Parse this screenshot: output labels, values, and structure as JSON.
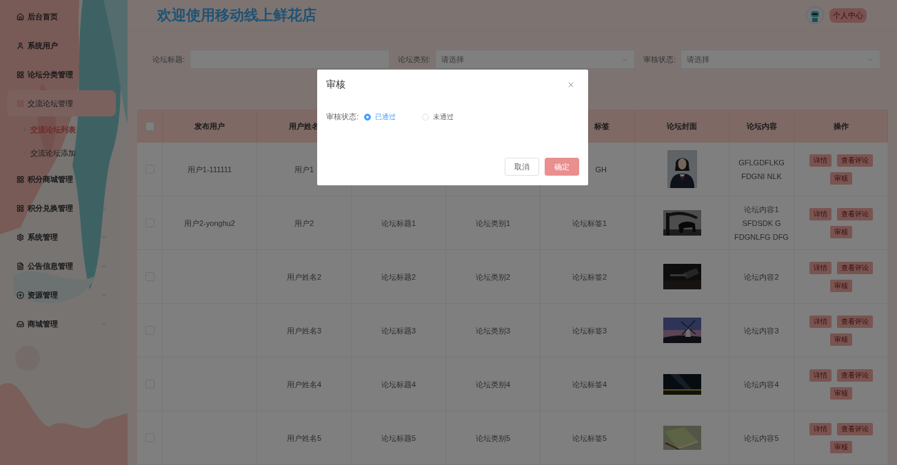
{
  "sidebar": {
    "items": [
      {
        "label": "后台首页",
        "kind": "link",
        "selected": false
      },
      {
        "label": "系统用户",
        "kind": "group",
        "selected": false,
        "expanded": false
      },
      {
        "label": "论坛分类管理",
        "kind": "group",
        "selected": false,
        "expanded": false
      },
      {
        "label": "交流论坛管理",
        "kind": "group",
        "selected": true,
        "expanded": true,
        "children": [
          {
            "label": "交流论坛列表",
            "selected": true
          },
          {
            "label": "交流论坛添加",
            "selected": false
          }
        ]
      },
      {
        "label": "积分商城管理",
        "kind": "group",
        "selected": false,
        "expanded": false
      },
      {
        "label": "积分兑换管理",
        "kind": "group",
        "selected": false,
        "expanded": false
      },
      {
        "label": "系统管理",
        "kind": "group",
        "selected": false,
        "expanded": false
      },
      {
        "label": "公告信息管理",
        "kind": "group",
        "selected": false,
        "expanded": false
      },
      {
        "label": "资源管理",
        "kind": "group",
        "selected": false,
        "expanded": false
      },
      {
        "label": "商城管理",
        "kind": "group",
        "selected": false,
        "expanded": false
      }
    ]
  },
  "header": {
    "title": "欢迎使用移动线上鲜花店",
    "profile_button": "个人中心"
  },
  "search": {
    "fields": [
      {
        "label": "论坛标题:",
        "kind": "input"
      },
      {
        "label": "论坛类别:",
        "kind": "select",
        "placeholder": "请选择"
      },
      {
        "label": "审核状态:",
        "kind": "select",
        "placeholder": "请选择"
      }
    ]
  },
  "table": {
    "select_all_checked": false,
    "columns": {
      "publisher": "发布用户",
      "user_name": "用户姓名",
      "tag": "标签",
      "cover": "论坛封面",
      "content": "论坛内容",
      "actions": "操作"
    },
    "rows": [
      {
        "checked": false,
        "publisher": "用户1-111111",
        "user_name": "用户1",
        "tag": "GH",
        "content": "GFLGDFLKG FDGNI NLK",
        "actions": [
          "详情",
          "查看评论",
          "审核"
        ]
      },
      {
        "checked": false,
        "publisher": "用户2-yonghu2",
        "user_name": "用户2",
        "title": "论坛标题1",
        "category": "论坛类别1",
        "tag": "论坛标签1",
        "content": "论坛内容1 SFDSDK G FDGNLFG DFG",
        "actions": [
          "详情",
          "查看评论",
          "审核"
        ]
      },
      {
        "checked": false,
        "user_name": "用户姓名2",
        "title": "论坛标题2",
        "category": "论坛类别2",
        "tag": "论坛标签2",
        "content": "论坛内容2",
        "actions": [
          "详情",
          "查看评论",
          "审核"
        ]
      },
      {
        "checked": false,
        "user_name": "用户姓名3",
        "title": "论坛标题3",
        "category": "论坛类别3",
        "tag": "论坛标签3",
        "content": "论坛内容3",
        "actions": [
          "详情",
          "查看评论",
          "审核"
        ]
      },
      {
        "checked": false,
        "user_name": "用户姓名4",
        "title": "论坛标题4",
        "category": "论坛类别4",
        "tag": "论坛标签4",
        "content": "论坛内容4",
        "actions": [
          "详情",
          "查看评论",
          "审核"
        ]
      },
      {
        "checked": false,
        "user_name": "用户姓名5",
        "title": "论坛标题5",
        "category": "论坛类别5",
        "tag": "论坛标签5",
        "content": "论坛内容5",
        "actions": [
          "详情",
          "查看评论",
          "审核"
        ]
      }
    ]
  },
  "dialog": {
    "title": "审核",
    "field": {
      "label": "审核状态:",
      "options": [
        {
          "label": "已通过",
          "selected": true
        },
        {
          "label": "未通过",
          "selected": false
        }
      ]
    },
    "buttons": [
      {
        "label": "取消",
        "kind": "default"
      },
      {
        "label": "确定",
        "kind": "primary"
      }
    ]
  }
}
